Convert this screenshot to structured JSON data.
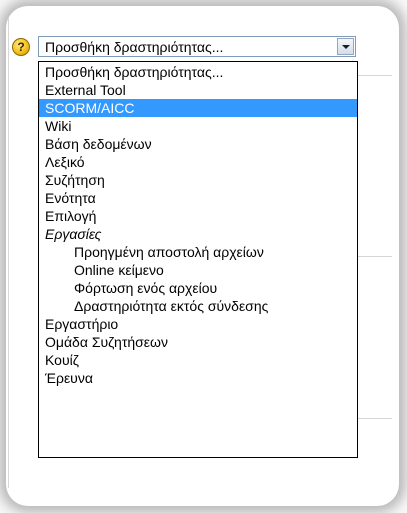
{
  "select": {
    "current_value": "Προσθήκη δραστηριότητας...",
    "help_icon_symbol": "?"
  },
  "options": [
    {
      "label": "Προσθήκη δραστηριότητας..."
    },
    {
      "label": "External Tool"
    },
    {
      "label": "SCORM/AICC",
      "selected": true
    },
    {
      "label": "Wiki"
    },
    {
      "label": "Βάση δεδομένων"
    },
    {
      "label": "Λεξικό"
    },
    {
      "label": "Συζήτηση"
    },
    {
      "label": "Ενότητα"
    },
    {
      "label": "Επιλογή"
    },
    {
      "label": "Εργασίες",
      "group": true
    },
    {
      "label": "Προηγμένη αποστολή αρχείων",
      "child": true
    },
    {
      "label": "Online κείμενο",
      "child": true
    },
    {
      "label": "Φόρτωση ενός αρχείου",
      "child": true
    },
    {
      "label": "Δραστηριότητα εκτός σύνδεσης",
      "child": true
    },
    {
      "label": "Εργαστήριο"
    },
    {
      "label": "Ομάδα Συζητήσεων"
    },
    {
      "label": "Κουίζ"
    },
    {
      "label": "Έρευνα"
    }
  ],
  "colors": {
    "selected_bg": "#3399ff",
    "selected_fg": "#ffffff",
    "help_icon": "#f3c21b"
  },
  "icons": {
    "help": "help-icon",
    "dropdown": "chevron-down-icon"
  }
}
